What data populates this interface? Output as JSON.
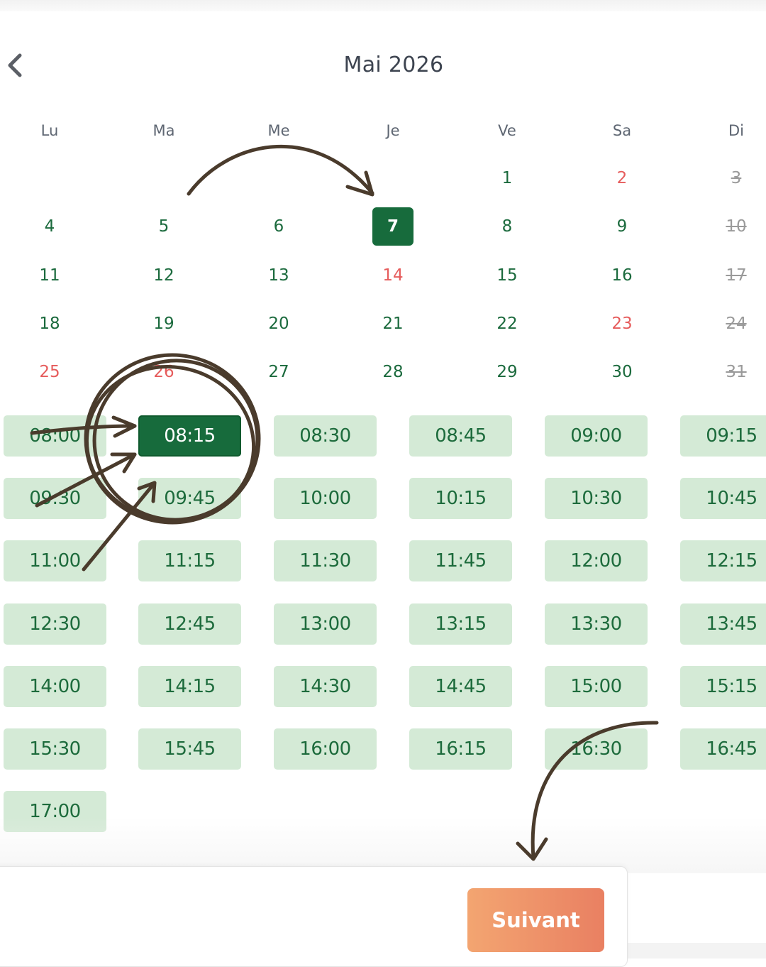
{
  "calendar": {
    "month_title": "Mai 2026",
    "weekdays": [
      "Lu",
      "Ma",
      "Me",
      "Je",
      "Ve",
      "Sa",
      "Di"
    ],
    "weeks": [
      [
        null,
        null,
        null,
        null,
        {
          "label": "1",
          "state": "normal"
        },
        {
          "label": "2",
          "state": "holiday"
        },
        {
          "label": "3",
          "state": "disabled"
        }
      ],
      [
        {
          "label": "4",
          "state": "normal"
        },
        {
          "label": "5",
          "state": "normal"
        },
        {
          "label": "6",
          "state": "normal"
        },
        {
          "label": "7",
          "state": "selected"
        },
        {
          "label": "8",
          "state": "normal"
        },
        {
          "label": "9",
          "state": "normal"
        },
        {
          "label": "10",
          "state": "disabled"
        }
      ],
      [
        {
          "label": "11",
          "state": "normal"
        },
        {
          "label": "12",
          "state": "normal"
        },
        {
          "label": "13",
          "state": "normal"
        },
        {
          "label": "14",
          "state": "holiday"
        },
        {
          "label": "15",
          "state": "normal"
        },
        {
          "label": "16",
          "state": "normal"
        },
        {
          "label": "17",
          "state": "disabled"
        }
      ],
      [
        {
          "label": "18",
          "state": "normal"
        },
        {
          "label": "19",
          "state": "normal"
        },
        {
          "label": "20",
          "state": "normal"
        },
        {
          "label": "21",
          "state": "normal"
        },
        {
          "label": "22",
          "state": "normal"
        },
        {
          "label": "23",
          "state": "holiday"
        },
        {
          "label": "24",
          "state": "disabled"
        }
      ],
      [
        {
          "label": "25",
          "state": "holiday"
        },
        {
          "label": "26",
          "state": "holiday"
        },
        {
          "label": "27",
          "state": "normal"
        },
        {
          "label": "28",
          "state": "normal"
        },
        {
          "label": "29",
          "state": "normal"
        },
        {
          "label": "30",
          "state": "normal"
        },
        {
          "label": "31",
          "state": "disabled"
        }
      ]
    ]
  },
  "timeslots": {
    "selected": "08:15",
    "slots": [
      "08:00",
      "08:15",
      "08:30",
      "08:45",
      "09:00",
      "09:15",
      "09:30",
      "09:45",
      "10:00",
      "10:15",
      "10:30",
      "10:45",
      "11:00",
      "11:15",
      "11:30",
      "11:45",
      "12:00",
      "12:15",
      "12:30",
      "12:45",
      "13:00",
      "13:15",
      "13:30",
      "13:45",
      "14:00",
      "14:15",
      "14:30",
      "14:45",
      "15:00",
      "15:15",
      "15:30",
      "15:45",
      "16:00",
      "16:15",
      "16:30",
      "16:45",
      "17:00"
    ]
  },
  "footer": {
    "next_label": "Suivant"
  },
  "icons": {
    "back": "chevron-left-icon"
  },
  "colors": {
    "primary_green": "#176b3c",
    "slot_green": "#d4ead6",
    "holiday_red": "#e65c5c",
    "accent_orange_start": "#f3a571",
    "accent_orange_end": "#e98062",
    "annotation_brown": "#4a3b2c"
  }
}
